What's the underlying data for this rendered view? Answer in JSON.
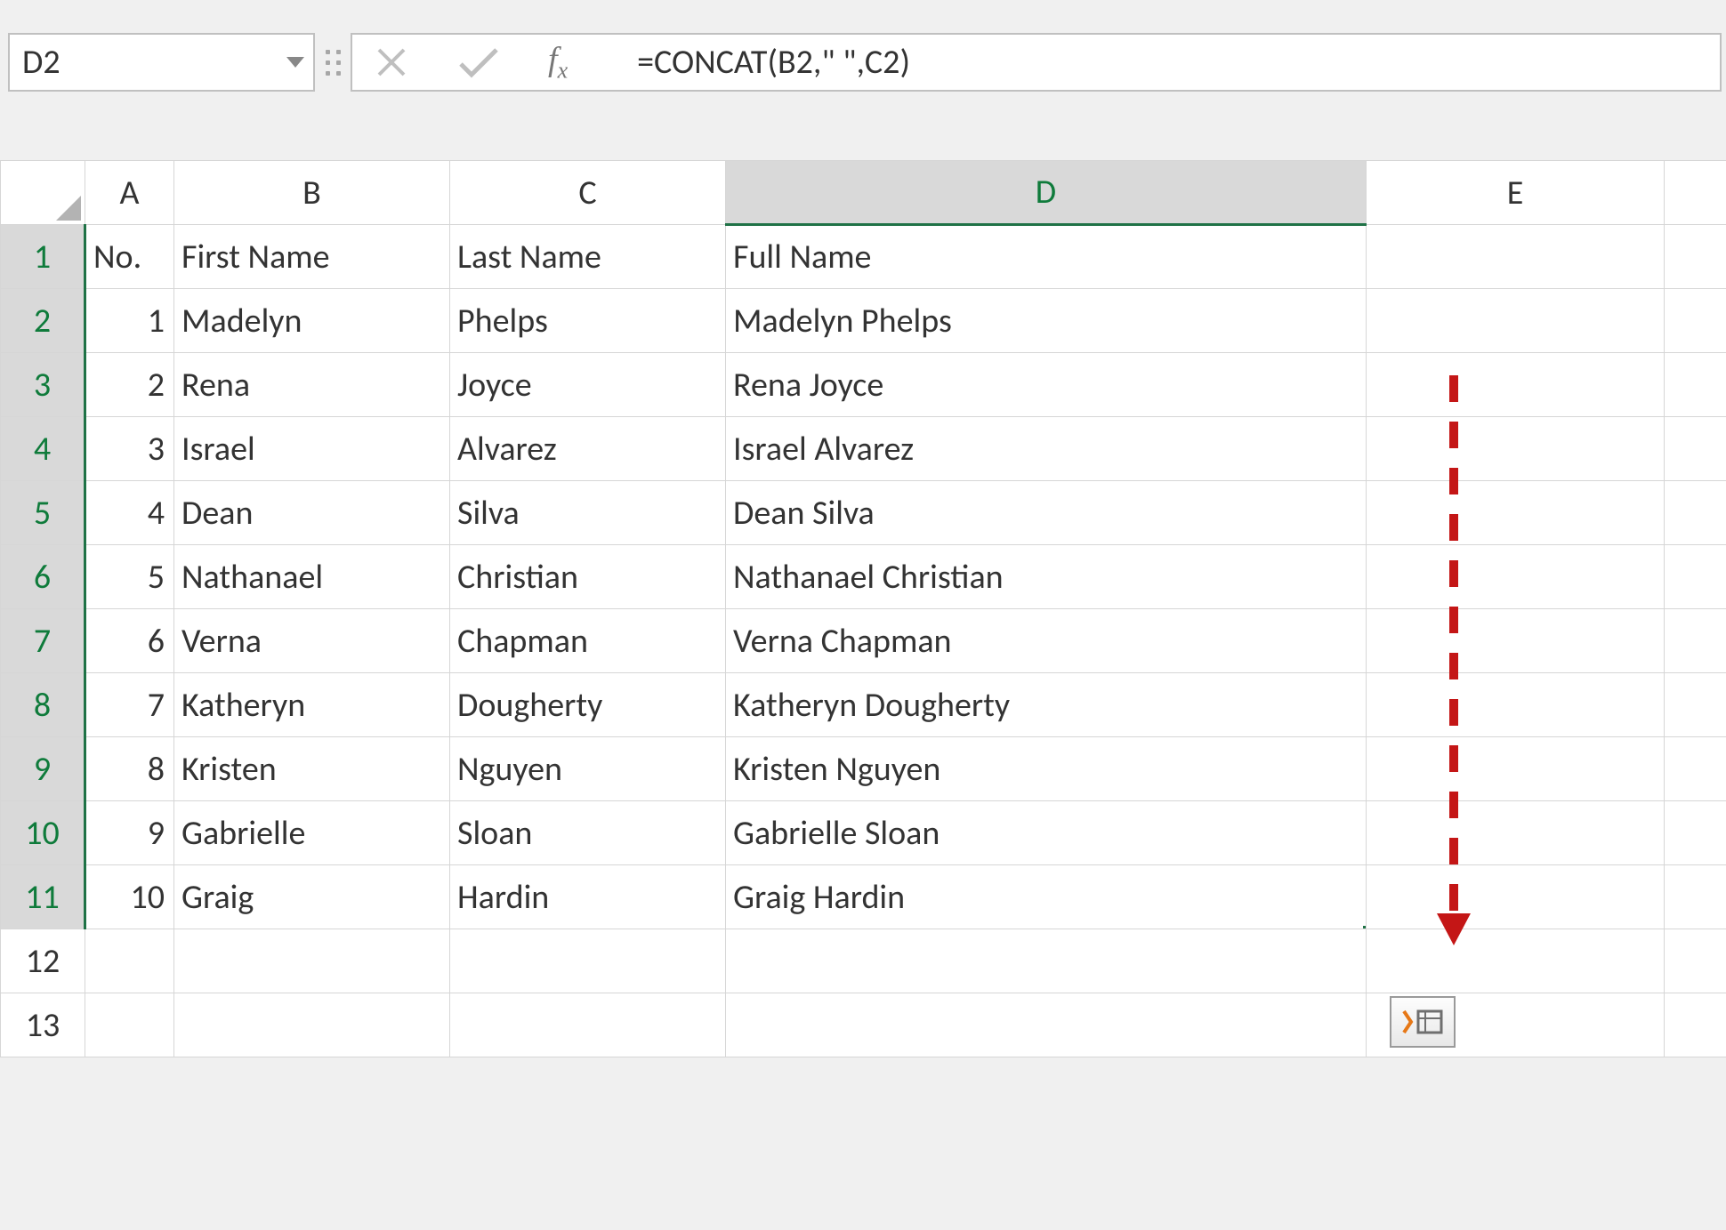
{
  "name_box": "D2",
  "formula": "=CONCAT(B2,\" \",C2)",
  "columns": [
    "A",
    "B",
    "C",
    "D",
    "E"
  ],
  "active_column": "D",
  "row_headers": [
    1,
    2,
    3,
    4,
    5,
    6,
    7,
    8,
    9,
    10,
    11,
    12,
    13
  ],
  "active_rows_start": 1,
  "active_rows_end": 11,
  "headers": {
    "A": "No.",
    "B": "First Name",
    "C": "Last Name",
    "D": "Full Name"
  },
  "rows": [
    {
      "no": 1,
      "first": "Madelyn",
      "last": "Phelps",
      "full": "Madelyn Phelps"
    },
    {
      "no": 2,
      "first": "Rena",
      "last": "Joyce",
      "full": "Rena Joyce"
    },
    {
      "no": 3,
      "first": "Israel",
      "last": "Alvarez",
      "full": "Israel Alvarez"
    },
    {
      "no": 4,
      "first": "Dean",
      "last": "Silva",
      "full": "Dean Silva"
    },
    {
      "no": 5,
      "first": "Nathanael",
      "last": "Christian",
      "full": "Nathanael Christian"
    },
    {
      "no": 6,
      "first": "Verna",
      "last": "Chapman",
      "full": "Verna Chapman"
    },
    {
      "no": 7,
      "first": "Katheryn",
      "last": "Dougherty",
      "full": "Katheryn Dougherty"
    },
    {
      "no": 8,
      "first": "Kristen",
      "last": "Nguyen",
      "full": "Kristen Nguyen"
    },
    {
      "no": 9,
      "first": "Gabrielle",
      "last": "Sloan",
      "full": "Gabrielle Sloan"
    },
    {
      "no": 10,
      "first": "Graig",
      "last": "Hardin",
      "full": "Graig Hardin"
    }
  ]
}
